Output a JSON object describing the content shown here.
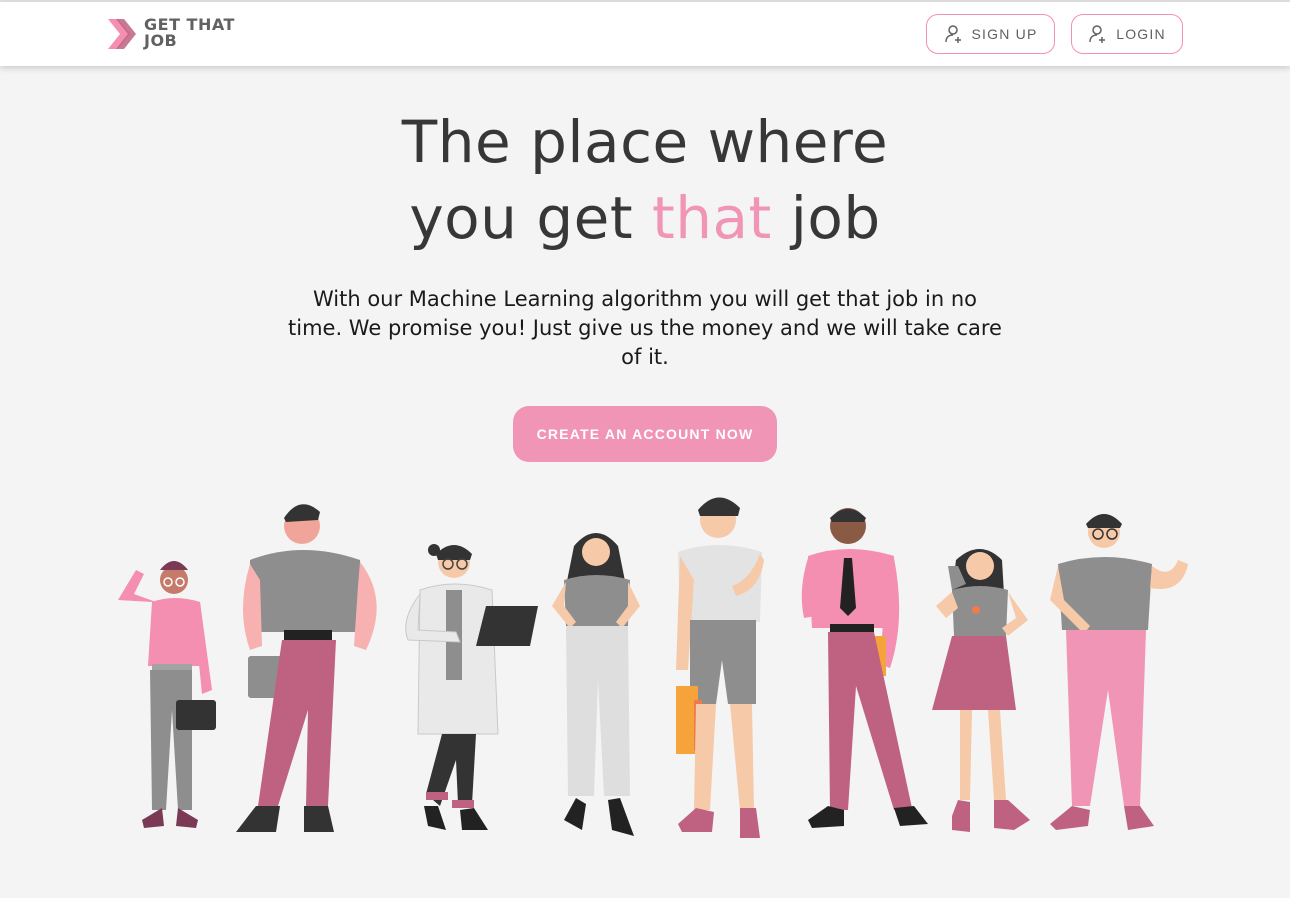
{
  "header": {
    "logo_line1": "GET THAT",
    "logo_line2": "JOB",
    "signup_label": "SIGN UP",
    "login_label": "LOGIN",
    "signup_icon": "user-plus-icon",
    "login_icon": "user-plus-icon"
  },
  "hero": {
    "title_line1": "The place where",
    "title_line2_a": "you get ",
    "title_line2_accent": "that",
    "title_line2_b": " job",
    "subtitle": "With our Machine Learning algorithm you will get that job in no time. We promise you! Just give us the money and we will take care of it.",
    "cta_label": "CREATE AN ACCOUNT NOW"
  },
  "colors": {
    "accent": "#f095b6",
    "text_dark": "#373737",
    "background": "#f4f4f4",
    "header_bg": "#ffffff",
    "pink": "#f48fb1",
    "mauve": "#bf6282",
    "gray": "#8e8e8e"
  }
}
